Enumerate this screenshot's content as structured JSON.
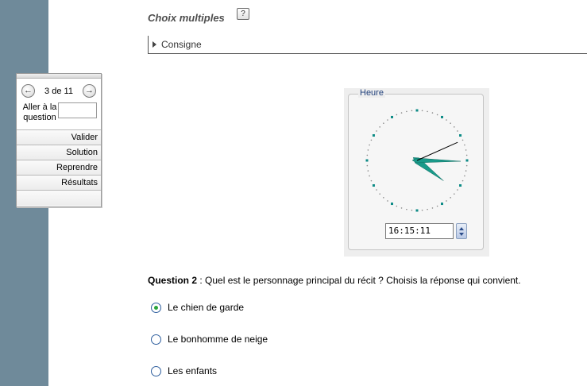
{
  "header": {
    "title": "Choix multiples",
    "help_symbol": "?",
    "consigne_label": "Consigne"
  },
  "navigation": {
    "prev_symbol": "←",
    "next_symbol": "→",
    "position": "3 de 11",
    "goto_label_line1": "Aller à la",
    "goto_label_line2": "question",
    "goto_value": "",
    "menu": [
      "Valider",
      "Solution",
      "Reprendre",
      "Résultats"
    ]
  },
  "clock": {
    "legend": "Heure",
    "time": "16:15:11",
    "hours": 16,
    "minutes": 15,
    "seconds": 11,
    "hand_color": "#1a9a8a",
    "marker_color": "#0d8b86"
  },
  "question": {
    "number_label": "Question 2",
    "text": " : Quel est le personnage principal du récit ? Choisis la réponse qui convient.",
    "options": [
      {
        "label": "Le chien de garde",
        "selected": true
      },
      {
        "label": "Le bonhomme de neige",
        "selected": false
      },
      {
        "label": "Les enfants",
        "selected": false
      }
    ]
  }
}
